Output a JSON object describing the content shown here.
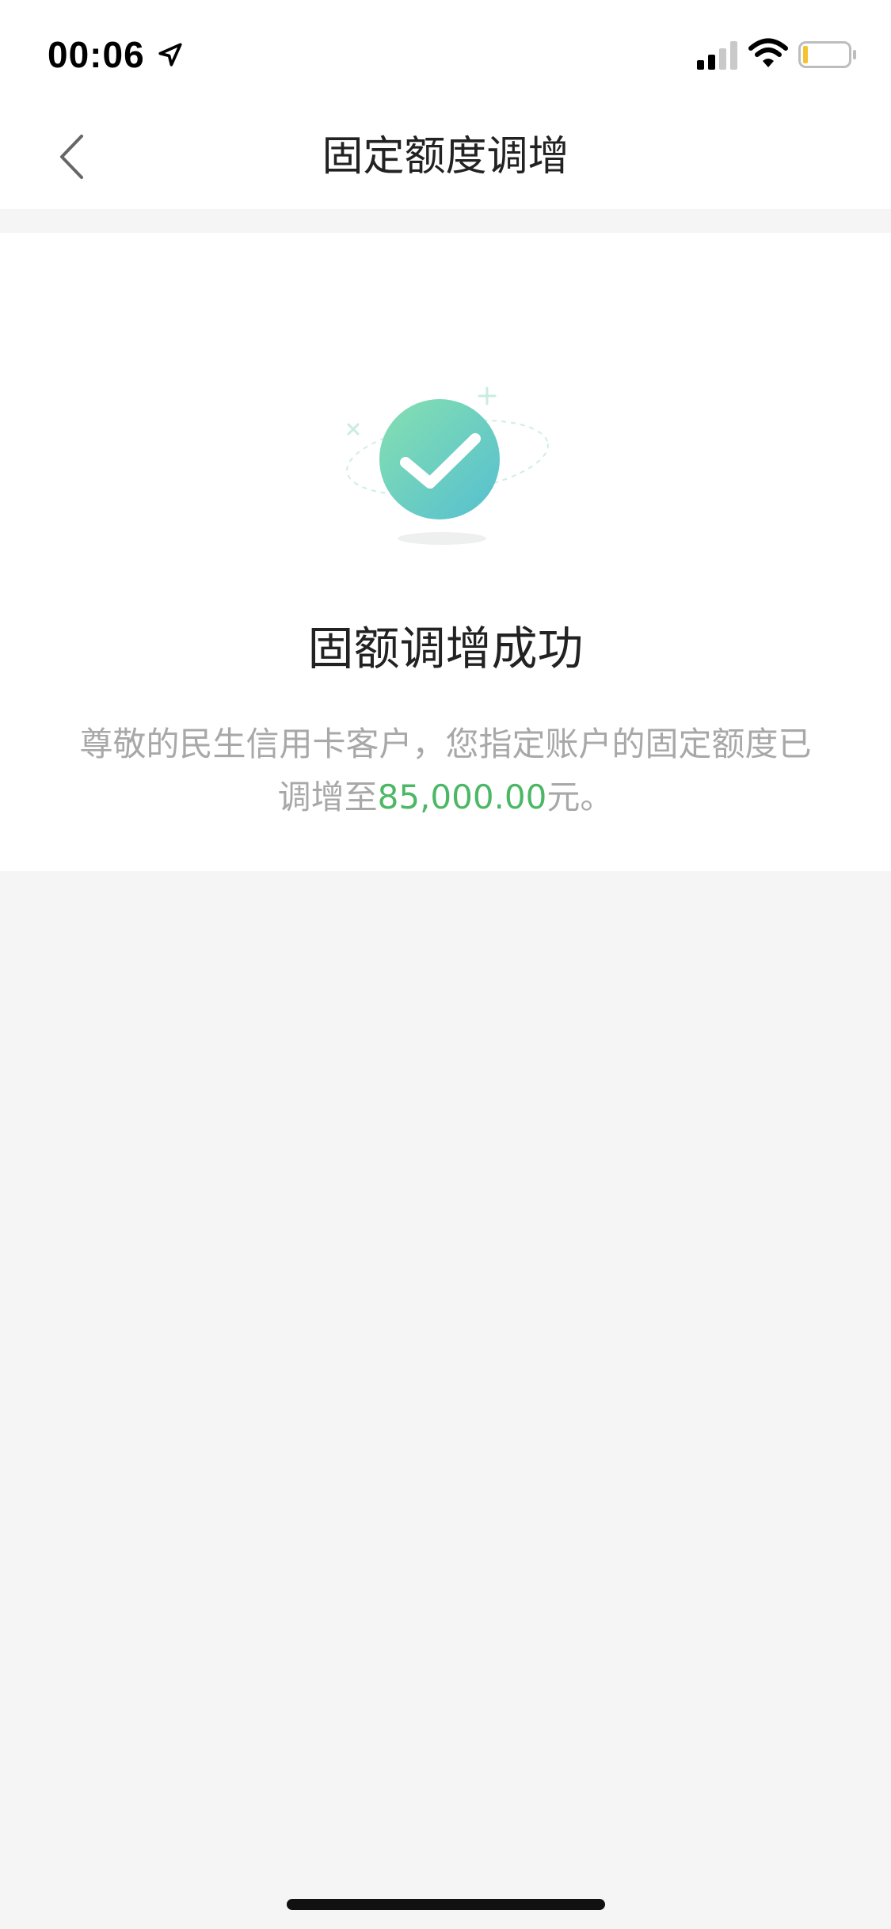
{
  "status_bar": {
    "time": "00:06"
  },
  "nav": {
    "title": "固定额度调增"
  },
  "result": {
    "title": "固额调增成功",
    "desc_prefix": "尊敬的民生信用卡客户，您指定账户的固定额度已调增至",
    "amount": "85,000.00",
    "desc_suffix": "元。"
  },
  "colors": {
    "accent_green": "#4cb866",
    "check_gradient_start": "#7edcb4",
    "check_gradient_end": "#5bc3c9",
    "muted_text": "#a8a8a8",
    "background": "#f5f5f5"
  }
}
